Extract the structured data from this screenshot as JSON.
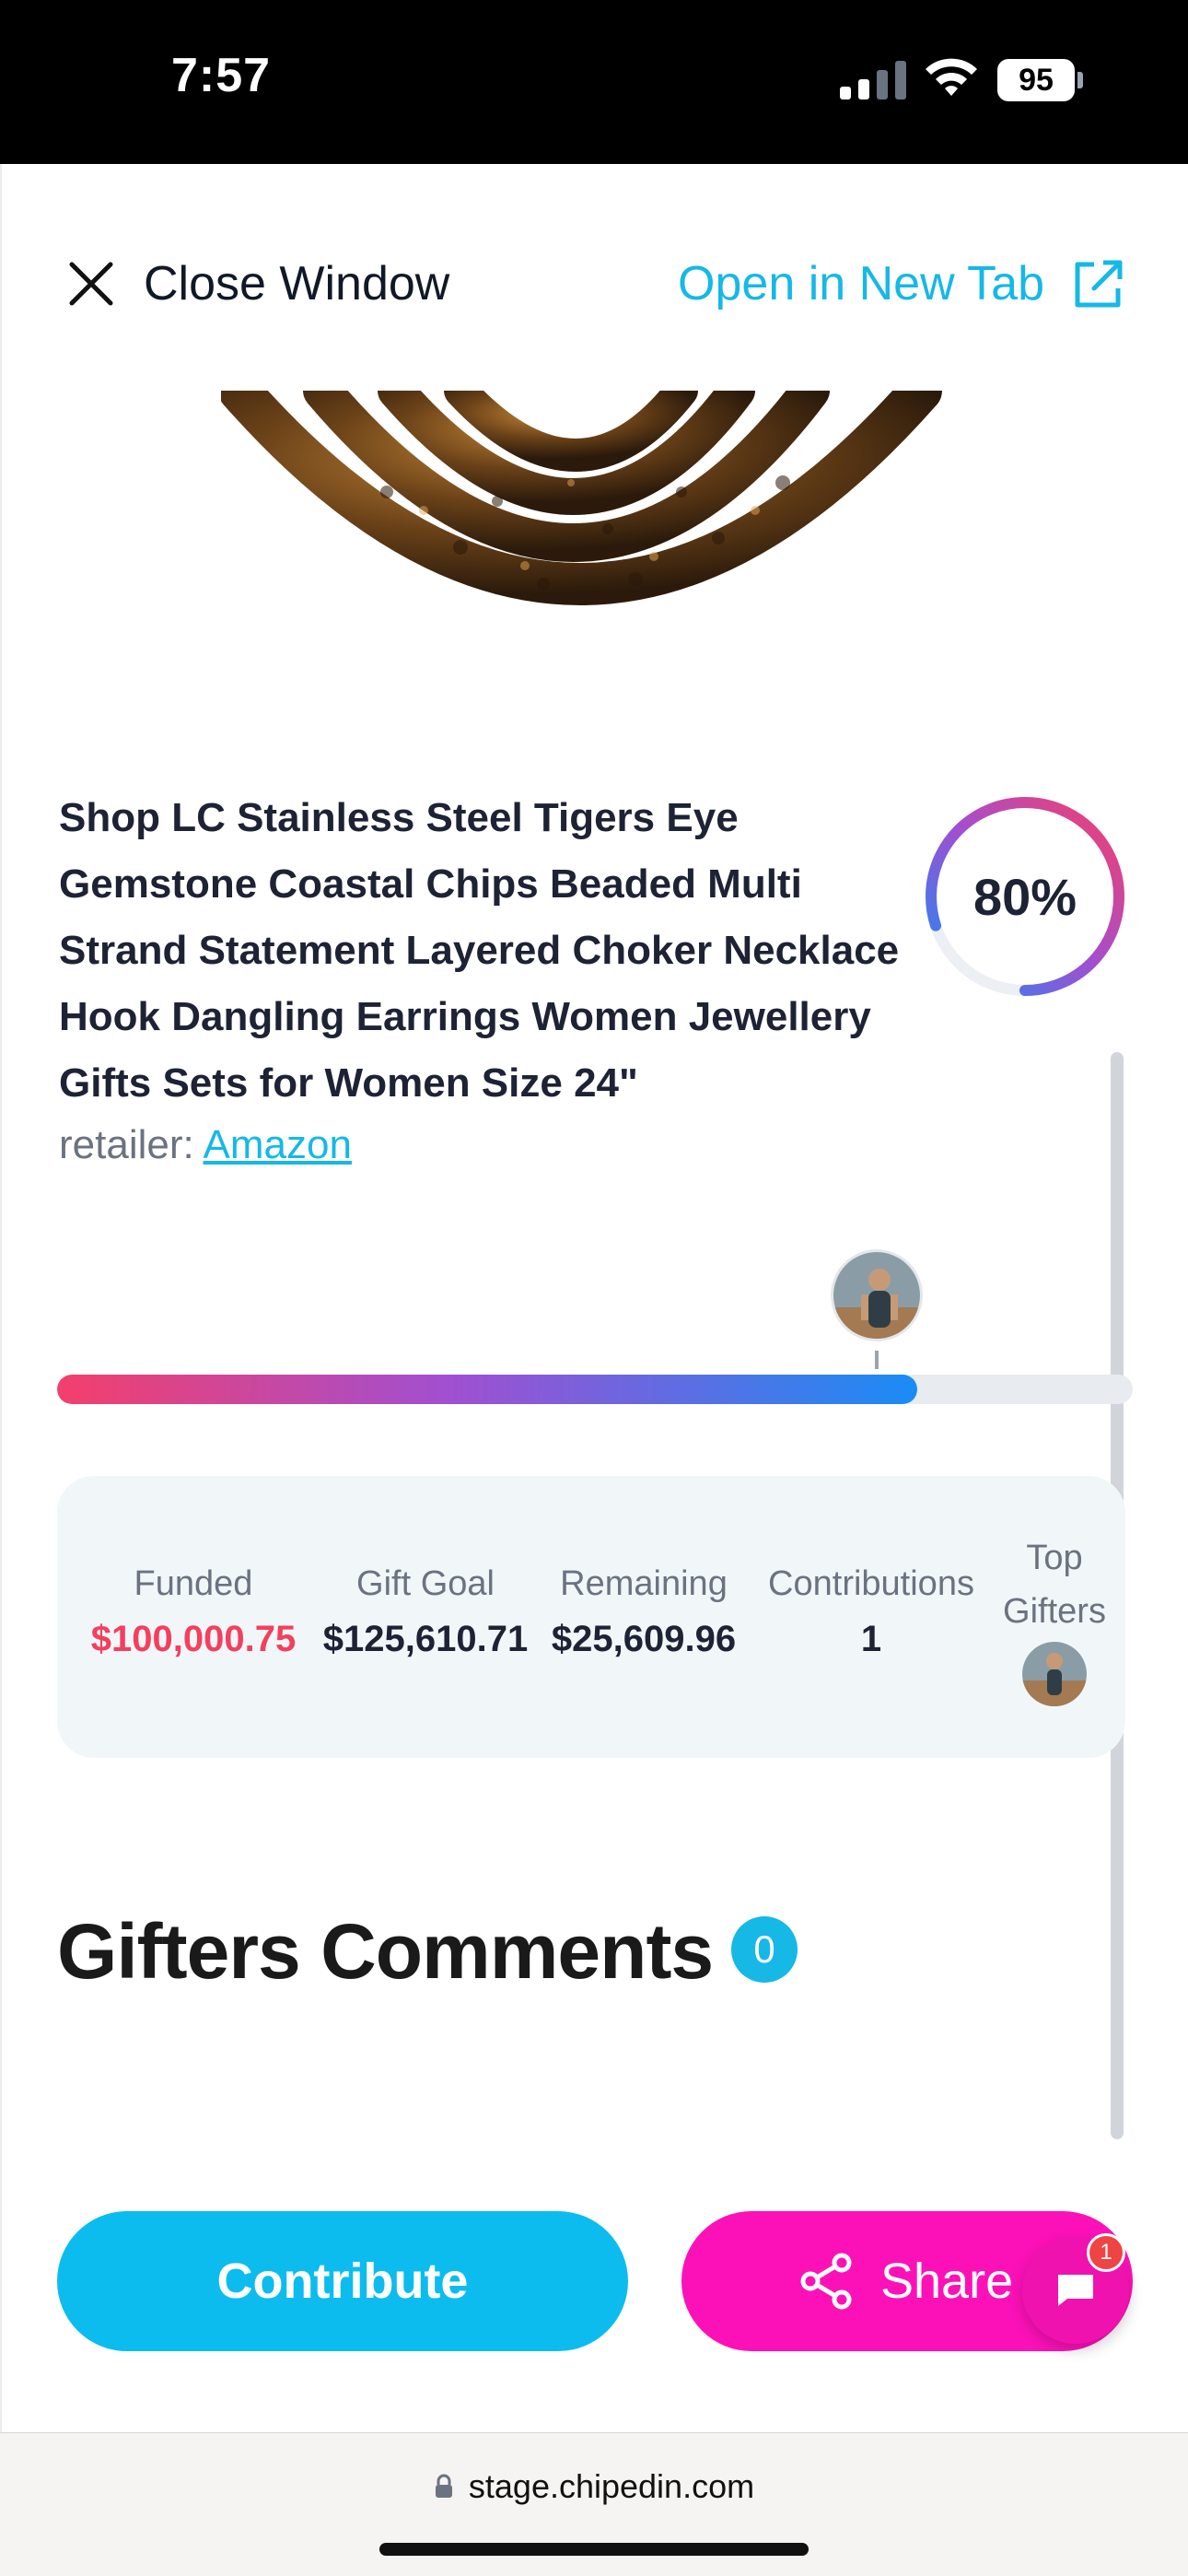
{
  "status_bar": {
    "time": "7:57",
    "battery": "95",
    "icons": [
      "signal-icon",
      "wifi-icon",
      "battery-icon"
    ]
  },
  "top_bar": {
    "close_label": "Close Window",
    "open_tab_label": "Open in New Tab",
    "accent_color": "#16b8e6"
  },
  "product": {
    "title": "Shop LC Stainless Steel Tigers Eye Gemstone Coastal Chips Beaded Multi Strand Statement Layered Choker Necklace Hook Dangling Earrings Women Jewellery Gifts Sets for Women Size 24\"",
    "retailer_prefix": "retailer:",
    "retailer_name": "Amazon",
    "progress_percent": "80%",
    "progress_value": 0.8
  },
  "funding": {
    "fill_fraction": 0.8,
    "stats": {
      "funded_label": "Funded",
      "funded_value": "$100,000.75",
      "goal_label": "Gift Goal",
      "goal_value": "$125,610.71",
      "remaining_label": "Remaining",
      "remaining_value": "$25,609.96",
      "contributions_label": "Contributions",
      "contributions_value": "1",
      "top_gifters_label": "Top Gifters"
    }
  },
  "comments": {
    "heading": "Gifters Comments",
    "count": "0"
  },
  "actions": {
    "contribute_label": "Contribute",
    "share_label": "Share",
    "chat_unread": "1"
  },
  "browser": {
    "url": "stage.chipedin.com"
  },
  "colors": {
    "contribute": "#0cbcef",
    "share": "#fc11b8",
    "funded": "#f43f5e"
  }
}
